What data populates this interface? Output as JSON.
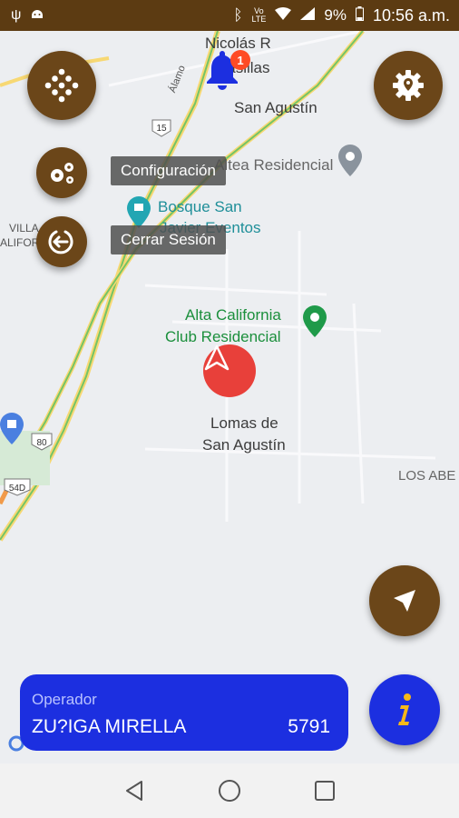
{
  "status_bar": {
    "time": "10:56 a.m.",
    "battery": "9%",
    "network_top": "Vo",
    "network_bottom": "LTE",
    "icons": [
      "usb-icon",
      "android-debug-icon",
      "bluetooth-icon",
      "wifi-icon",
      "signal-icon",
      "battery-icon"
    ]
  },
  "map": {
    "labels": {
      "nicolas": "Nicolás R",
      "casillas": "Casillas",
      "san_agustin": "San Agustín",
      "altea": "Altea Residencial",
      "bosque_1": "Bosque San",
      "bosque_2": "Javier Eventos",
      "alta_cal_1": "Alta California",
      "alta_cal_2": "Club Residencial",
      "lomas_1": "Lomas de",
      "lomas_2": "San Agustín",
      "los_abe": "LOS ABE",
      "villa_1": "VILLA",
      "villa_2": "ALIFOR",
      "alamo": "Álamo"
    },
    "route_shields": [
      "15",
      "80",
      "54D"
    ]
  },
  "notifications": {
    "count": "1"
  },
  "menu": {
    "config_label": "Configuración",
    "logout_label": "Cerrar Sesión"
  },
  "operator": {
    "role": "Operador",
    "name": "ZU?IGA MIRELLA",
    "code": "5791"
  },
  "colors": {
    "brown": "#6b4619",
    "blue": "#1c2fe0",
    "status_bar": "#5c3b12",
    "alert_red": "#e8403a"
  }
}
